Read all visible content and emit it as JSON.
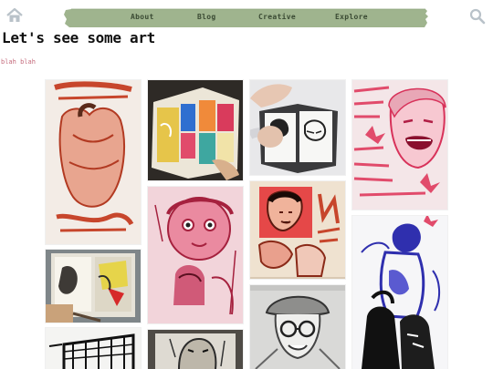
{
  "nav": {
    "home_icon": "home-icon",
    "search_icon": "search-icon",
    "banner_color": "#9fb48e",
    "links": [
      {
        "label": "About"
      },
      {
        "label": "Blog"
      },
      {
        "label": "Creative"
      },
      {
        "label": "Explore"
      }
    ]
  },
  "page": {
    "title": "Let's see some art",
    "subtitle": "blah blah"
  },
  "gallery": {
    "accent_colors": [
      "#c7462c",
      "#e14b6b",
      "#2f2fae",
      "#1a1a1a"
    ]
  }
}
